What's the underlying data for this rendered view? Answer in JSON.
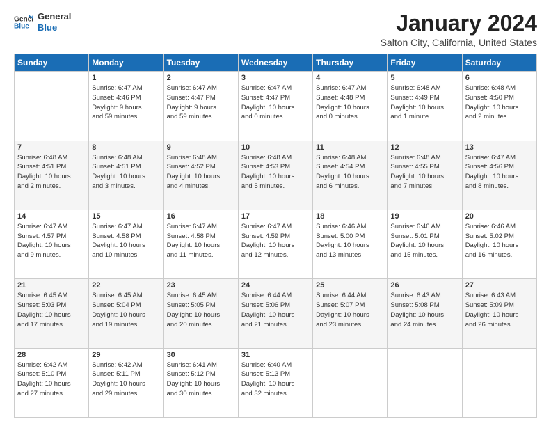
{
  "logo": {
    "line1": "General",
    "line2": "Blue"
  },
  "title": "January 2024",
  "location": "Salton City, California, United States",
  "headers": [
    "Sunday",
    "Monday",
    "Tuesday",
    "Wednesday",
    "Thursday",
    "Friday",
    "Saturday"
  ],
  "weeks": [
    [
      {
        "day": "",
        "info": ""
      },
      {
        "day": "1",
        "info": "Sunrise: 6:47 AM\nSunset: 4:46 PM\nDaylight: 9 hours\nand 59 minutes."
      },
      {
        "day": "2",
        "info": "Sunrise: 6:47 AM\nSunset: 4:47 PM\nDaylight: 9 hours\nand 59 minutes."
      },
      {
        "day": "3",
        "info": "Sunrise: 6:47 AM\nSunset: 4:47 PM\nDaylight: 10 hours\nand 0 minutes."
      },
      {
        "day": "4",
        "info": "Sunrise: 6:47 AM\nSunset: 4:48 PM\nDaylight: 10 hours\nand 0 minutes."
      },
      {
        "day": "5",
        "info": "Sunrise: 6:48 AM\nSunset: 4:49 PM\nDaylight: 10 hours\nand 1 minute."
      },
      {
        "day": "6",
        "info": "Sunrise: 6:48 AM\nSunset: 4:50 PM\nDaylight: 10 hours\nand 2 minutes."
      }
    ],
    [
      {
        "day": "7",
        "info": "Sunrise: 6:48 AM\nSunset: 4:51 PM\nDaylight: 10 hours\nand 2 minutes."
      },
      {
        "day": "8",
        "info": "Sunrise: 6:48 AM\nSunset: 4:51 PM\nDaylight: 10 hours\nand 3 minutes."
      },
      {
        "day": "9",
        "info": "Sunrise: 6:48 AM\nSunset: 4:52 PM\nDaylight: 10 hours\nand 4 minutes."
      },
      {
        "day": "10",
        "info": "Sunrise: 6:48 AM\nSunset: 4:53 PM\nDaylight: 10 hours\nand 5 minutes."
      },
      {
        "day": "11",
        "info": "Sunrise: 6:48 AM\nSunset: 4:54 PM\nDaylight: 10 hours\nand 6 minutes."
      },
      {
        "day": "12",
        "info": "Sunrise: 6:48 AM\nSunset: 4:55 PM\nDaylight: 10 hours\nand 7 minutes."
      },
      {
        "day": "13",
        "info": "Sunrise: 6:47 AM\nSunset: 4:56 PM\nDaylight: 10 hours\nand 8 minutes."
      }
    ],
    [
      {
        "day": "14",
        "info": "Sunrise: 6:47 AM\nSunset: 4:57 PM\nDaylight: 10 hours\nand 9 minutes."
      },
      {
        "day": "15",
        "info": "Sunrise: 6:47 AM\nSunset: 4:58 PM\nDaylight: 10 hours\nand 10 minutes."
      },
      {
        "day": "16",
        "info": "Sunrise: 6:47 AM\nSunset: 4:58 PM\nDaylight: 10 hours\nand 11 minutes."
      },
      {
        "day": "17",
        "info": "Sunrise: 6:47 AM\nSunset: 4:59 PM\nDaylight: 10 hours\nand 12 minutes."
      },
      {
        "day": "18",
        "info": "Sunrise: 6:46 AM\nSunset: 5:00 PM\nDaylight: 10 hours\nand 13 minutes."
      },
      {
        "day": "19",
        "info": "Sunrise: 6:46 AM\nSunset: 5:01 PM\nDaylight: 10 hours\nand 15 minutes."
      },
      {
        "day": "20",
        "info": "Sunrise: 6:46 AM\nSunset: 5:02 PM\nDaylight: 10 hours\nand 16 minutes."
      }
    ],
    [
      {
        "day": "21",
        "info": "Sunrise: 6:45 AM\nSunset: 5:03 PM\nDaylight: 10 hours\nand 17 minutes."
      },
      {
        "day": "22",
        "info": "Sunrise: 6:45 AM\nSunset: 5:04 PM\nDaylight: 10 hours\nand 19 minutes."
      },
      {
        "day": "23",
        "info": "Sunrise: 6:45 AM\nSunset: 5:05 PM\nDaylight: 10 hours\nand 20 minutes."
      },
      {
        "day": "24",
        "info": "Sunrise: 6:44 AM\nSunset: 5:06 PM\nDaylight: 10 hours\nand 21 minutes."
      },
      {
        "day": "25",
        "info": "Sunrise: 6:44 AM\nSunset: 5:07 PM\nDaylight: 10 hours\nand 23 minutes."
      },
      {
        "day": "26",
        "info": "Sunrise: 6:43 AM\nSunset: 5:08 PM\nDaylight: 10 hours\nand 24 minutes."
      },
      {
        "day": "27",
        "info": "Sunrise: 6:43 AM\nSunset: 5:09 PM\nDaylight: 10 hours\nand 26 minutes."
      }
    ],
    [
      {
        "day": "28",
        "info": "Sunrise: 6:42 AM\nSunset: 5:10 PM\nDaylight: 10 hours\nand 27 minutes."
      },
      {
        "day": "29",
        "info": "Sunrise: 6:42 AM\nSunset: 5:11 PM\nDaylight: 10 hours\nand 29 minutes."
      },
      {
        "day": "30",
        "info": "Sunrise: 6:41 AM\nSunset: 5:12 PM\nDaylight: 10 hours\nand 30 minutes."
      },
      {
        "day": "31",
        "info": "Sunrise: 6:40 AM\nSunset: 5:13 PM\nDaylight: 10 hours\nand 32 minutes."
      },
      {
        "day": "",
        "info": ""
      },
      {
        "day": "",
        "info": ""
      },
      {
        "day": "",
        "info": ""
      }
    ]
  ]
}
